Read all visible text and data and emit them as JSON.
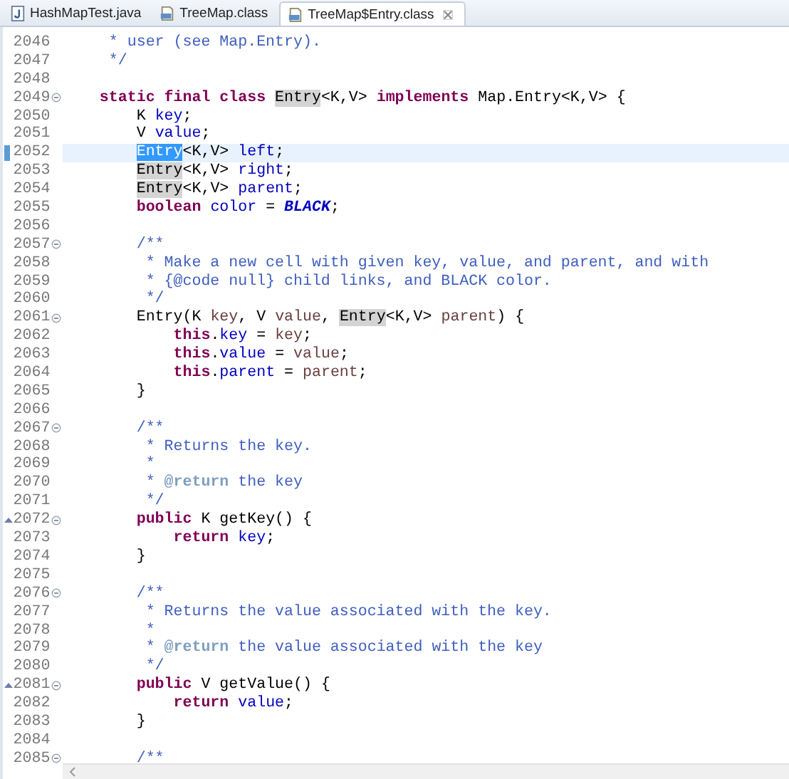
{
  "tabs": [
    {
      "label": "HashMapTest.java",
      "kind": "java",
      "selected": false
    },
    {
      "label": "TreeMap.class",
      "kind": "class",
      "selected": false
    },
    {
      "label": "TreeMap$Entry.class",
      "kind": "class",
      "selected": true
    }
  ],
  "editor": {
    "lines": [
      {
        "number": "2046",
        "fold_marker": false,
        "override": false,
        "current": false,
        "tokens": [
          {
            "kind": "comment",
            "text": "     * user (see Map.Entry)."
          }
        ]
      },
      {
        "number": "2047",
        "fold_marker": false,
        "override": false,
        "current": false,
        "tokens": [
          {
            "kind": "comment",
            "text": "     */"
          }
        ]
      },
      {
        "number": "2048",
        "fold_marker": false,
        "override": false,
        "current": false
      },
      {
        "number": "2049",
        "fold_marker": true,
        "override": false,
        "current": false,
        "tokens": [
          {
            "kind": "keyword",
            "text": "    static final class "
          },
          {
            "kind": "occurrence",
            "text": "Entry"
          },
          {
            "kind": "plain",
            "text": "<K,V> "
          },
          {
            "kind": "keyword",
            "text": "implements"
          },
          {
            "kind": "plain",
            "text": " Map.Entry<K,V> {"
          }
        ]
      },
      {
        "number": "2050",
        "fold_marker": false,
        "override": false,
        "current": false,
        "tokens": [
          {
            "kind": "plain",
            "text": "        K "
          },
          {
            "kind": "field",
            "text": "key"
          },
          {
            "kind": "plain",
            "text": ";"
          }
        ]
      },
      {
        "number": "2051",
        "fold_marker": false,
        "override": false,
        "current": false,
        "tokens": [
          {
            "kind": "plain",
            "text": "        V "
          },
          {
            "kind": "field",
            "text": "value"
          },
          {
            "kind": "plain",
            "text": ";"
          }
        ]
      },
      {
        "number": "2052",
        "fold_marker": false,
        "override": false,
        "current": true,
        "tokens": [
          {
            "kind": "selection",
            "text": "        Entry"
          },
          {
            "kind": "plain",
            "text": "<K,V> "
          },
          {
            "kind": "field",
            "text": "left"
          },
          {
            "kind": "plain",
            "text": ";"
          }
        ]
      },
      {
        "number": "2053",
        "fold_marker": false,
        "override": false,
        "current": false,
        "tokens": [
          {
            "kind": "occurrence",
            "text": "        Entry"
          },
          {
            "kind": "plain",
            "text": "<K,V> "
          },
          {
            "kind": "field",
            "text": "right"
          },
          {
            "kind": "plain",
            "text": ";"
          }
        ]
      },
      {
        "number": "2054",
        "fold_marker": false,
        "override": false,
        "current": false,
        "tokens": [
          {
            "kind": "occurrence",
            "text": "        Entry"
          },
          {
            "kind": "plain",
            "text": "<K,V> "
          },
          {
            "kind": "field",
            "text": "parent"
          },
          {
            "kind": "plain",
            "text": ";"
          }
        ]
      },
      {
        "number": "2055",
        "fold_marker": false,
        "override": false,
        "current": false,
        "tokens": [
          {
            "kind": "keyword",
            "text": "        boolean "
          },
          {
            "kind": "field",
            "text": "color"
          },
          {
            "kind": "plain",
            "text": " = "
          },
          {
            "kind": "constant",
            "text": "BLACK"
          },
          {
            "kind": "plain",
            "text": ";"
          }
        ]
      },
      {
        "number": "2056",
        "fold_marker": false,
        "override": false,
        "current": false
      },
      {
        "number": "2057",
        "fold_marker": true,
        "override": false,
        "current": false,
        "tokens": [
          {
            "kind": "comment",
            "text": "        /**"
          }
        ]
      },
      {
        "number": "2058",
        "fold_marker": false,
        "override": false,
        "current": false,
        "tokens": [
          {
            "kind": "comment",
            "text": "         * Make a new cell with given key, value, and parent, and with"
          }
        ]
      },
      {
        "number": "2059",
        "fold_marker": false,
        "override": false,
        "current": false,
        "tokens": [
          {
            "kind": "comment",
            "text": "         * {@code null} child links, and BLACK color."
          }
        ]
      },
      {
        "number": "2060",
        "fold_marker": false,
        "override": false,
        "current": false,
        "tokens": [
          {
            "kind": "comment",
            "text": "         */"
          }
        ]
      },
      {
        "number": "2061",
        "fold_marker": true,
        "override": false,
        "current": false,
        "tokens": [
          {
            "kind": "plain",
            "text": "        Entry(K "
          },
          {
            "kind": "local",
            "text": "key"
          },
          {
            "kind": "plain",
            "text": ", V "
          },
          {
            "kind": "local",
            "text": "value"
          },
          {
            "kind": "plain",
            "text": ", "
          },
          {
            "kind": "occurrence",
            "text": "Entry"
          },
          {
            "kind": "plain",
            "text": "<K,V> "
          },
          {
            "kind": "local",
            "text": "parent"
          },
          {
            "kind": "plain",
            "text": ") {"
          }
        ]
      },
      {
        "number": "2062",
        "fold_marker": false,
        "override": false,
        "current": false,
        "tokens": [
          {
            "kind": "keyword",
            "text": "            this"
          },
          {
            "kind": "plain",
            "text": "."
          },
          {
            "kind": "field",
            "text": "key"
          },
          {
            "kind": "plain",
            "text": " = "
          },
          {
            "kind": "local",
            "text": "key"
          },
          {
            "kind": "plain",
            "text": ";"
          }
        ]
      },
      {
        "number": "2063",
        "fold_marker": false,
        "override": false,
        "current": false,
        "tokens": [
          {
            "kind": "keyword",
            "text": "            this"
          },
          {
            "kind": "plain",
            "text": "."
          },
          {
            "kind": "field",
            "text": "value"
          },
          {
            "kind": "plain",
            "text": " = "
          },
          {
            "kind": "local",
            "text": "value"
          },
          {
            "kind": "plain",
            "text": ";"
          }
        ]
      },
      {
        "number": "2064",
        "fold_marker": false,
        "override": false,
        "current": false,
        "tokens": [
          {
            "kind": "keyword",
            "text": "            this"
          },
          {
            "kind": "plain",
            "text": "."
          },
          {
            "kind": "field",
            "text": "parent"
          },
          {
            "kind": "plain",
            "text": " = "
          },
          {
            "kind": "local",
            "text": "parent"
          },
          {
            "kind": "plain",
            "text": ";"
          }
        ]
      },
      {
        "number": "2065",
        "fold_marker": false,
        "override": false,
        "current": false,
        "tokens": [
          {
            "kind": "plain",
            "text": "        }"
          }
        ]
      },
      {
        "number": "2066",
        "fold_marker": false,
        "override": false,
        "current": false
      },
      {
        "number": "2067",
        "fold_marker": true,
        "override": false,
        "current": false,
        "tokens": [
          {
            "kind": "comment",
            "text": "        /**"
          }
        ]
      },
      {
        "number": "2068",
        "fold_marker": false,
        "override": false,
        "current": false,
        "tokens": [
          {
            "kind": "comment",
            "text": "         * Returns the key."
          }
        ]
      },
      {
        "number": "2069",
        "fold_marker": false,
        "override": false,
        "current": false,
        "tokens": [
          {
            "kind": "comment",
            "text": "         *"
          }
        ]
      },
      {
        "number": "2070",
        "fold_marker": false,
        "override": false,
        "current": false,
        "tokens": [
          {
            "kind": "comment",
            "text": "         * "
          },
          {
            "kind": "doc_tag",
            "text": "@return"
          },
          {
            "kind": "comment",
            "text": " the key"
          }
        ]
      },
      {
        "number": "2071",
        "fold_marker": false,
        "override": false,
        "current": false,
        "tokens": [
          {
            "kind": "comment",
            "text": "         */"
          }
        ]
      },
      {
        "number": "2072",
        "fold_marker": true,
        "override": true,
        "current": false,
        "tokens": [
          {
            "kind": "keyword",
            "text": "        public"
          },
          {
            "kind": "plain",
            "text": " K getKey() {"
          }
        ]
      },
      {
        "number": "2073",
        "fold_marker": false,
        "override": false,
        "current": false,
        "tokens": [
          {
            "kind": "keyword",
            "text": "            return "
          },
          {
            "kind": "field",
            "text": "key"
          },
          {
            "kind": "plain",
            "text": ";"
          }
        ]
      },
      {
        "number": "2074",
        "fold_marker": false,
        "override": false,
        "current": false,
        "tokens": [
          {
            "kind": "plain",
            "text": "        }"
          }
        ]
      },
      {
        "number": "2075",
        "fold_marker": false,
        "override": false,
        "current": false
      },
      {
        "number": "2076",
        "fold_marker": true,
        "override": false,
        "current": false,
        "tokens": [
          {
            "kind": "comment",
            "text": "        /**"
          }
        ]
      },
      {
        "number": "2077",
        "fold_marker": false,
        "override": false,
        "current": false,
        "tokens": [
          {
            "kind": "comment",
            "text": "         * Returns the value associated with the key."
          }
        ]
      },
      {
        "number": "2078",
        "fold_marker": false,
        "override": false,
        "current": false,
        "tokens": [
          {
            "kind": "comment",
            "text": "         *"
          }
        ]
      },
      {
        "number": "2079",
        "fold_marker": false,
        "override": false,
        "current": false,
        "tokens": [
          {
            "kind": "comment",
            "text": "         * "
          },
          {
            "kind": "doc_tag",
            "text": "@return"
          },
          {
            "kind": "comment",
            "text": " the value associated with the key"
          }
        ]
      },
      {
        "number": "2080",
        "fold_marker": false,
        "override": false,
        "current": false,
        "tokens": [
          {
            "kind": "comment",
            "text": "         */"
          }
        ]
      },
      {
        "number": "2081",
        "fold_marker": true,
        "override": true,
        "current": false,
        "tokens": [
          {
            "kind": "keyword",
            "text": "        public"
          },
          {
            "kind": "plain",
            "text": " V getValue() {"
          }
        ]
      },
      {
        "number": "2082",
        "fold_marker": false,
        "override": false,
        "current": false,
        "tokens": [
          {
            "kind": "keyword",
            "text": "            return "
          },
          {
            "kind": "field",
            "text": "value"
          },
          {
            "kind": "plain",
            "text": ";"
          }
        ]
      },
      {
        "number": "2083",
        "fold_marker": false,
        "override": false,
        "current": false,
        "tokens": [
          {
            "kind": "plain",
            "text": "        }"
          }
        ]
      },
      {
        "number": "2084",
        "fold_marker": false,
        "override": false,
        "current": false
      },
      {
        "number": "2085",
        "fold_marker": true,
        "override": false,
        "current": false,
        "tokens": [
          {
            "kind": "comment",
            "text": "        /**"
          }
        ]
      }
    ]
  }
}
